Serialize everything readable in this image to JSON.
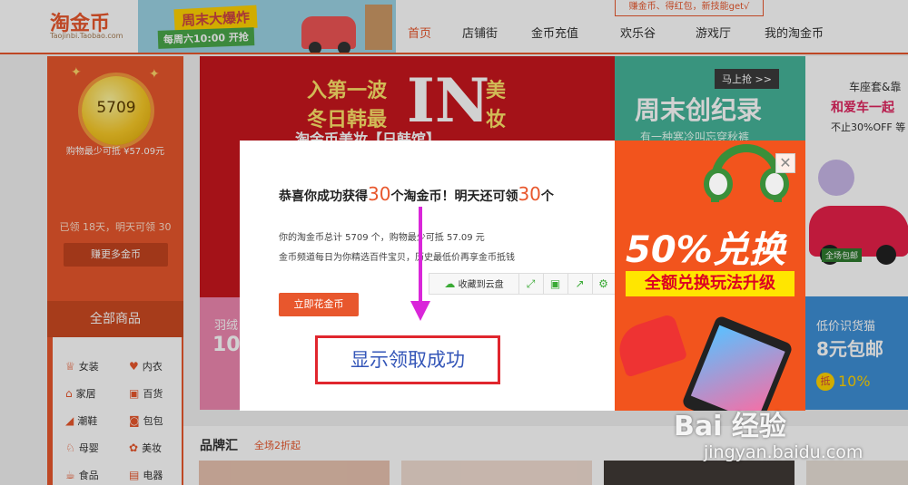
{
  "header": {
    "logo": "淘金币",
    "logo_sub": "Taojinbi.Taobao.com",
    "promo_title": "周末大爆炸",
    "promo_time": "每周六10:00 开抢",
    "tip": "赚金币、得红包，新技能get√",
    "nav": [
      "首页",
      "店铺街",
      "金币充值",
      "欢乐谷",
      "游戏厅",
      "我的淘金币"
    ],
    "active_tab": "首页"
  },
  "left": {
    "coin_count": "5709",
    "min_buy": "购物最少可抵 ¥57.09元",
    "claimed": "已领 18天，明天可领 30",
    "earn_more": "赚更多金币",
    "categories_title": "全部商品",
    "categories": [
      {
        "icon": "dress-icon",
        "glyph": "♕",
        "label": "女装"
      },
      {
        "icon": "underwear-icon",
        "glyph": "♥",
        "label": "内衣"
      },
      {
        "icon": "home-icon",
        "glyph": "⌂",
        "label": "家居"
      },
      {
        "icon": "grocery-icon",
        "glyph": "▣",
        "label": "百货"
      },
      {
        "icon": "shoe-icon",
        "glyph": "◢",
        "label": "潮鞋"
      },
      {
        "icon": "bag-icon",
        "glyph": "◙",
        "label": "包包"
      },
      {
        "icon": "baby-icon",
        "glyph": "♘",
        "label": "母婴"
      },
      {
        "icon": "beauty-icon",
        "glyph": "✿",
        "label": "美妆"
      },
      {
        "icon": "food-icon",
        "glyph": "☕",
        "label": "食品"
      },
      {
        "icon": "appliance-icon",
        "glyph": "▤",
        "label": "电器"
      }
    ]
  },
  "banner": {
    "line1": "入第一波",
    "line2": "冬日韩最",
    "big": "IN",
    "side1": "美",
    "side2": "妆",
    "sub": "淘金币美妆【日韩馆】",
    "pink_text": "羽绒",
    "pink_num": "10"
  },
  "right_top": {
    "tag": "马上抢 >>",
    "title": "周末创纪录",
    "sub": "有一种寒冷叫忘穿秋裤"
  },
  "right_side": {
    "title": "车座套&靠",
    "sub": "和爱车一起",
    "note": "不止30%OFF 等",
    "badge": "全场包邮",
    "low_title": "低价识货猫",
    "low_price": "8元包邮",
    "low_tag": "抵",
    "low_pct": "10%"
  },
  "brand": {
    "title": "品牌汇",
    "sub": "全场2折起"
  },
  "modal": {
    "title_a": "恭喜你成功获得",
    "title_n1": "30",
    "title_b": "个淘金币！明天还可领",
    "title_n2": "30",
    "title_c": "个",
    "line1": "你的淘金币总计 5709 个，购物最少可抵 57.09 元",
    "line2": "金币频道每日为你精选百件宝贝，历史最低价再享金币抵钱",
    "spend_btn": "立即花金币",
    "toolbar_save": "收藏到云盘",
    "promo_big": "50%兑换",
    "promo_bar": "全额兑换玩法升级"
  },
  "annotation": {
    "callout": "显示领取成功"
  },
  "watermark": {
    "logo": "Bai 经验",
    "url": "jingyan.baidu.com"
  },
  "colors": {
    "brand": "#e8572d",
    "annotation_arrow": "#d926d9",
    "callout_border": "#e0262e"
  }
}
